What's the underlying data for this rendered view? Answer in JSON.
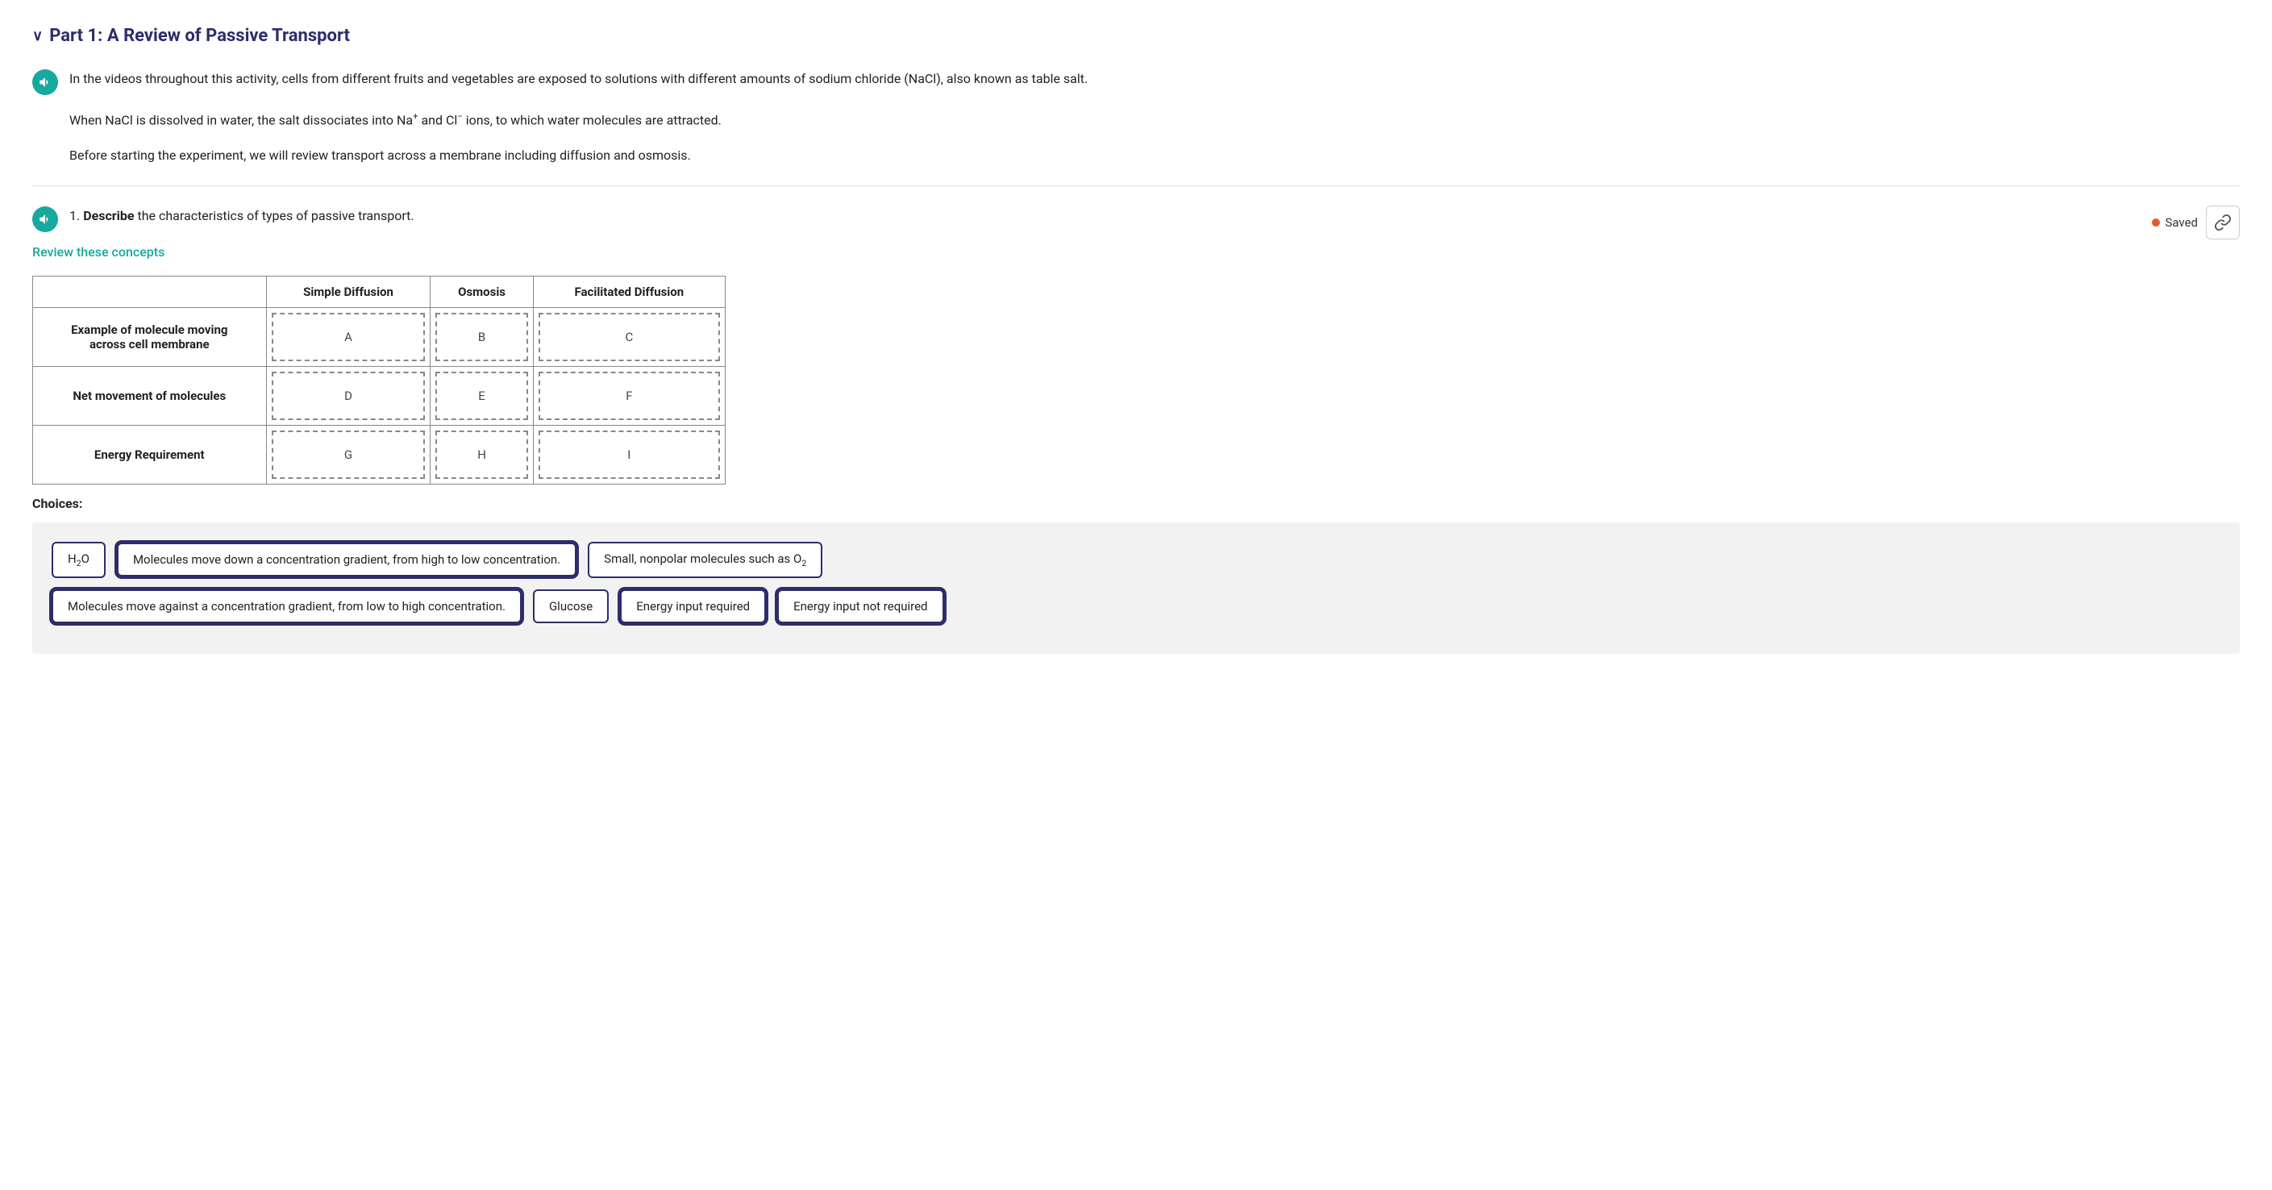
{
  "page": {
    "part_header": "Part 1: A Review of Passive Transport",
    "intro": {
      "line1": "In the videos throughout this activity, cells from different fruits and vegetables are exposed to solutions with different amounts of sodium chloride (NaCl), also known as table salt.",
      "line2_pre": "When NaCl is dissolved in water, the salt dissociates into Na",
      "line2_superscript": "+",
      "line2_mid": " and Cl",
      "line2_superscript2": "−",
      "line2_post": " ions, to which water molecules are attracted.",
      "line3": "Before starting the experiment, we will review transport across a membrane including diffusion and osmosis."
    },
    "question": {
      "number": "1.",
      "bold": "Describe",
      "rest": " the characteristics of types of passive transport.",
      "saved_label": "Saved",
      "review_link": "Review these concepts"
    },
    "table": {
      "col_headers": [
        "",
        "Simple Diffusion",
        "Osmosis",
        "Facilitated Diffusion"
      ],
      "rows": [
        {
          "header": "Example of molecule moving across cell membrane",
          "cells": [
            "A",
            "B",
            "C"
          ]
        },
        {
          "header": "Net movement of molecules",
          "cells": [
            "D",
            "E",
            "F"
          ]
        },
        {
          "header": "Energy Requirement",
          "cells": [
            "G",
            "H",
            "I"
          ]
        }
      ]
    },
    "choices": {
      "label": "Choices:",
      "row1": [
        {
          "text": "H₂O",
          "subscript": true
        },
        {
          "text": "Molecules move down a concentration gradient, from high to low concentration.",
          "double": true
        },
        {
          "text": "Small, nonpolar molecules such as O₂",
          "subscript_o2": true
        }
      ],
      "row2": [
        {
          "text": "Molecules move against a concentration gradient, from low to high concentration.",
          "double": true
        },
        {
          "text": "Glucose"
        },
        {
          "text": "Energy input required",
          "double": true
        },
        {
          "text": "Energy input not required",
          "double": true
        }
      ]
    }
  }
}
